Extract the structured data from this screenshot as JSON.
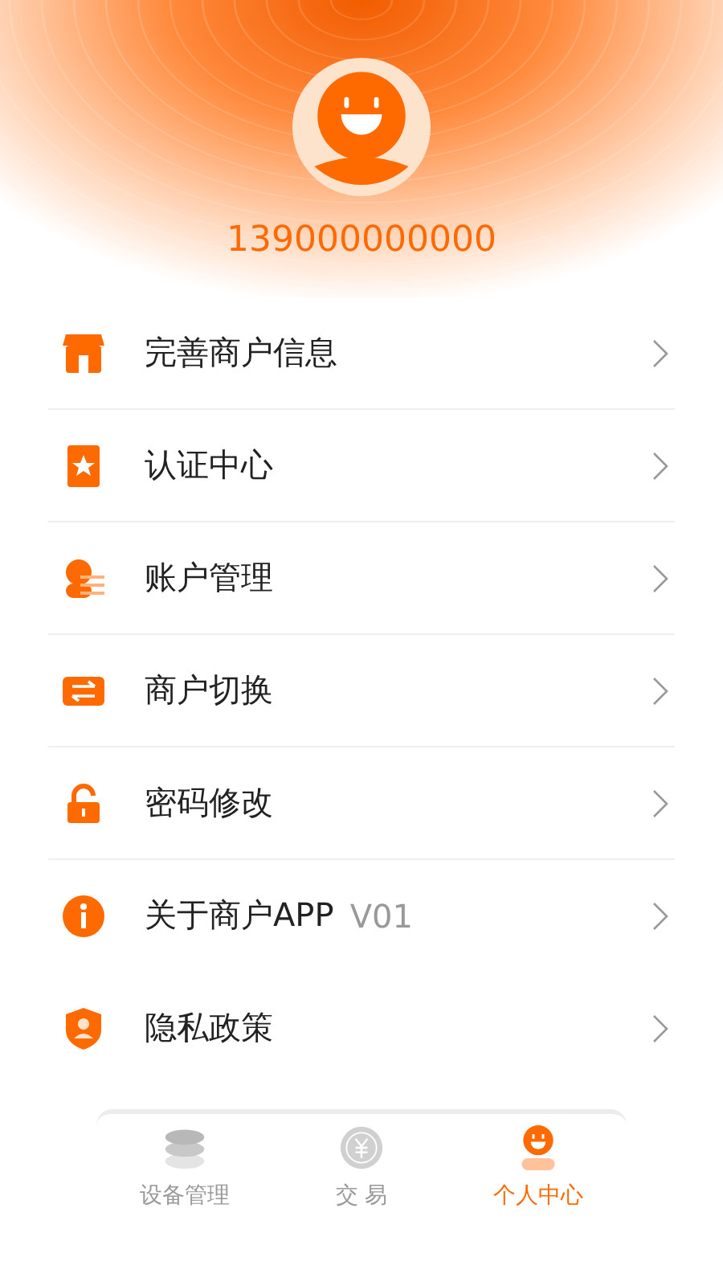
{
  "profile": {
    "phone": "139000000000"
  },
  "menu": [
    {
      "kind": "store",
      "label": "完善商户信息",
      "divider": true
    },
    {
      "kind": "badge",
      "label": "认证中心",
      "divider": true
    },
    {
      "kind": "account",
      "label": "账户管理",
      "divider": true
    },
    {
      "kind": "switch",
      "label": "商户切换",
      "divider": true
    },
    {
      "kind": "lock",
      "label": "密码修改",
      "divider": true
    },
    {
      "kind": "info",
      "label": "关于商户APP",
      "version": "V01",
      "divider": false
    },
    {
      "kind": "shield",
      "label": "隐私政策",
      "divider": false
    }
  ],
  "tabs": [
    {
      "kind": "devices",
      "label": "设备管理",
      "selected": false
    },
    {
      "kind": "trade",
      "label": "交 易",
      "selected": false
    },
    {
      "kind": "profile",
      "label": "个人中心",
      "selected": true
    }
  ]
}
